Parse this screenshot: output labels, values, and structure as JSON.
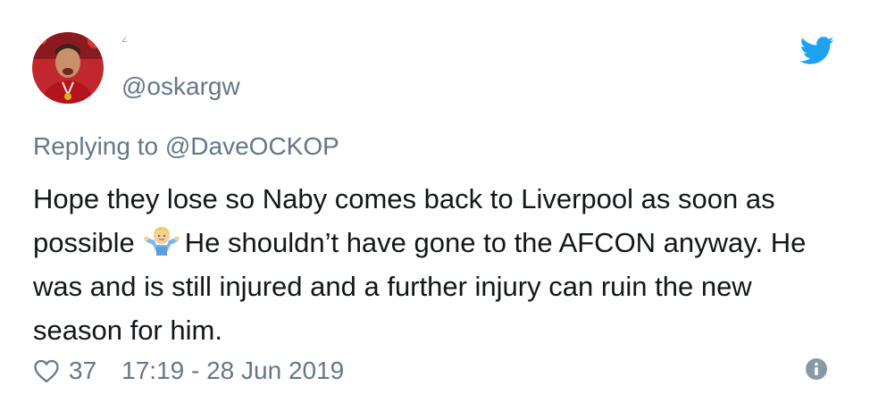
{
  "tweet": {
    "display_name": "∠",
    "handle": "@oskargw",
    "reply_prefix": "Replying to",
    "reply_to": "@DaveOCKOP",
    "text_part1": "Hope they lose so Naby comes back to Liverpool as soon as possible",
    "emoji_name": "man-shrugging-emoji",
    "text_part2": "He shouldn’t have gone to the AFCON anyway. He was and is still injured and a further injury can ruin the new season for him.",
    "like_count": "37",
    "timestamp": "17:19 - 28 Jun 2019"
  },
  "icons": {
    "brand": "twitter-bird-icon",
    "like": "heart-icon",
    "info": "info-icon"
  },
  "colors": {
    "twitter_blue": "#1da1f2",
    "text_primary": "#14171a",
    "text_secondary": "#657786"
  }
}
